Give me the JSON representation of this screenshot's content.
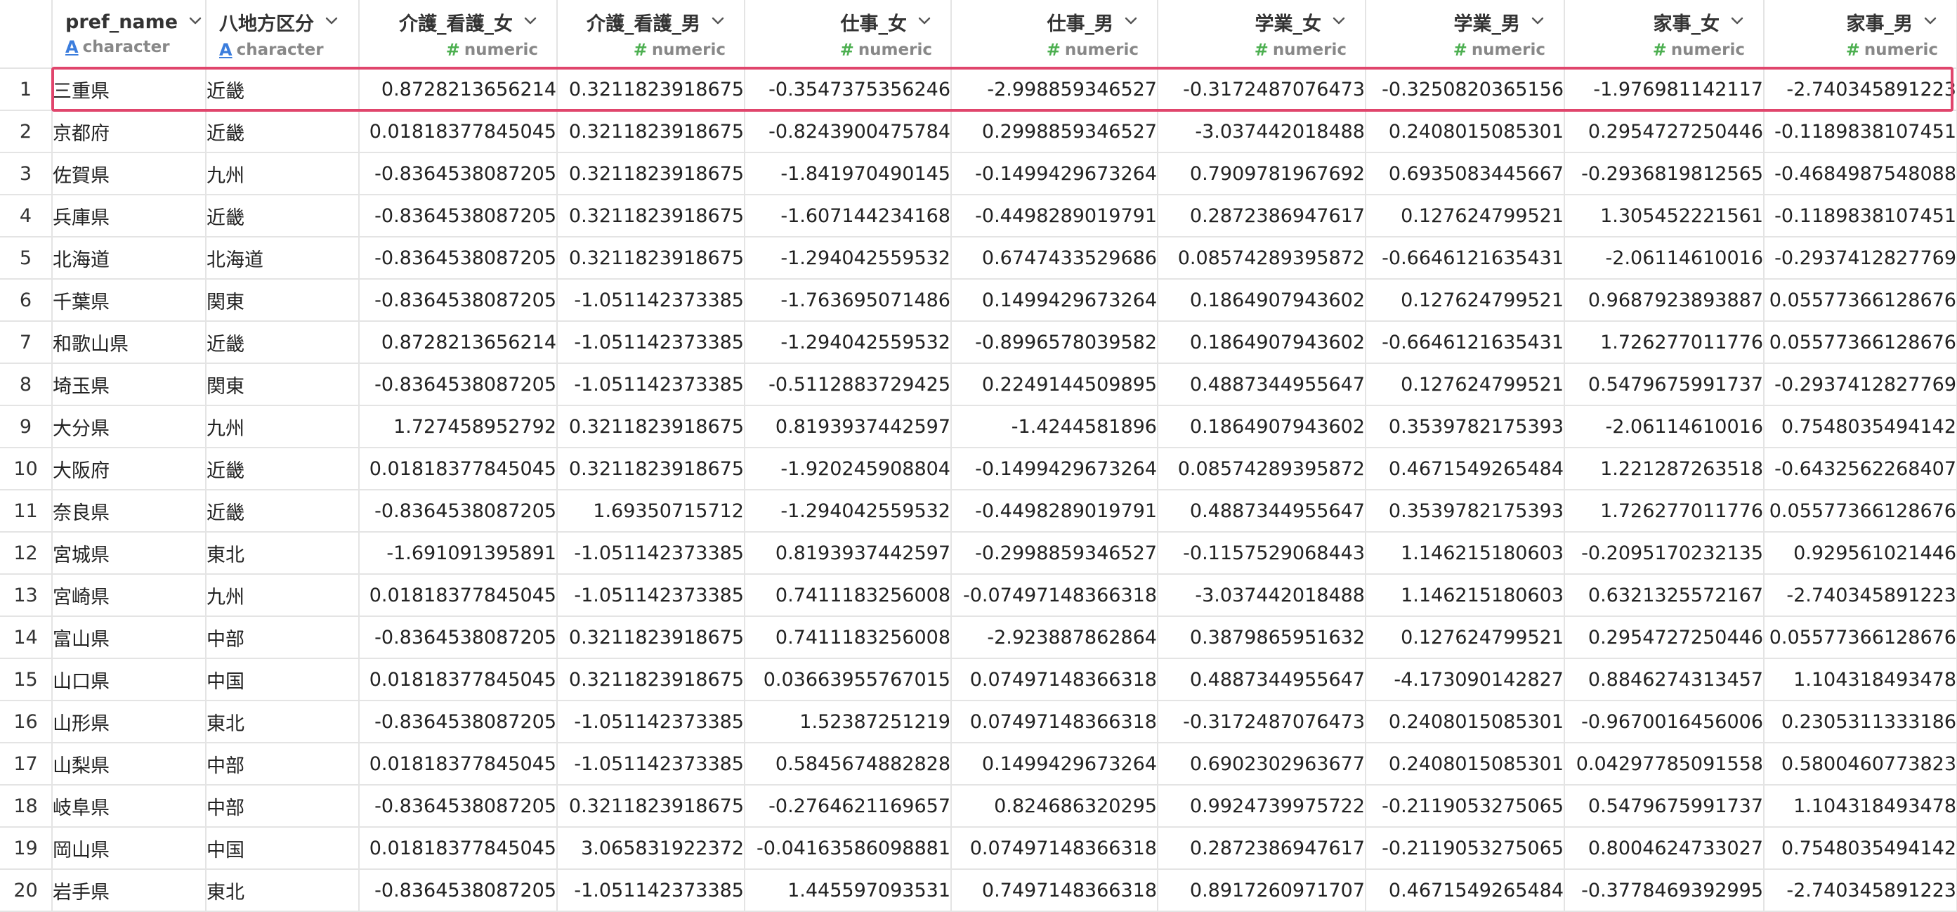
{
  "columns": [
    {
      "name": "pref_name",
      "type": "character"
    },
    {
      "name": "八地方区分",
      "type": "character"
    },
    {
      "name": "介護_看護_女",
      "type": "numeric"
    },
    {
      "name": "介護_看護_男",
      "type": "numeric"
    },
    {
      "name": "仕事_女",
      "type": "numeric"
    },
    {
      "name": "仕事_男",
      "type": "numeric"
    },
    {
      "name": "学業_女",
      "type": "numeric"
    },
    {
      "name": "学業_男",
      "type": "numeric"
    },
    {
      "name": "家事_女",
      "type": "numeric"
    },
    {
      "name": "家事_男",
      "type": "numeric"
    }
  ],
  "rows": [
    {
      "n": "1",
      "cells": [
        "三重県",
        "近畿",
        "0.8728213656214",
        "0.3211823918675",
        "-0.3547375356246",
        "-2.998859346527",
        "-0.3172487076473",
        "-0.3250820365156",
        "-1.976981142117",
        "-2.740345891223"
      ]
    },
    {
      "n": "2",
      "cells": [
        "京都府",
        "近畿",
        "0.01818377845045",
        "0.3211823918675",
        "-0.8243900475784",
        "0.2998859346527",
        "-3.037442018488",
        "0.2408015085301",
        "0.2954727250446",
        "-0.1189838107451"
      ]
    },
    {
      "n": "3",
      "cells": [
        "佐賀県",
        "九州",
        "-0.8364538087205",
        "0.3211823918675",
        "-1.841970490145",
        "-0.1499429673264",
        "0.7909781967692",
        "0.6935083445667",
        "-0.2936819812565",
        "-0.4684987548088"
      ]
    },
    {
      "n": "4",
      "cells": [
        "兵庫県",
        "近畿",
        "-0.8364538087205",
        "0.3211823918675",
        "-1.607144234168",
        "-0.4498289019791",
        "0.2872386947617",
        "0.127624799521",
        "1.305452221561",
        "-0.1189838107451"
      ]
    },
    {
      "n": "5",
      "cells": [
        "北海道",
        "北海道",
        "-0.8364538087205",
        "0.3211823918675",
        "-1.294042559532",
        "0.6747433529686",
        "0.08574289395872",
        "-0.6646121635431",
        "-2.06114610016",
        "-0.2937412827769"
      ]
    },
    {
      "n": "6",
      "cells": [
        "千葉県",
        "関東",
        "-0.8364538087205",
        "-1.051142373385",
        "-1.763695071486",
        "0.1499429673264",
        "0.1864907943602",
        "0.127624799521",
        "0.9687923893887",
        "0.05577366128676"
      ]
    },
    {
      "n": "7",
      "cells": [
        "和歌山県",
        "近畿",
        "0.8728213656214",
        "-1.051142373385",
        "-1.294042559532",
        "-0.8996578039582",
        "0.1864907943602",
        "-0.6646121635431",
        "1.726277011776",
        "0.05577366128676"
      ]
    },
    {
      "n": "8",
      "cells": [
        "埼玉県",
        "関東",
        "-0.8364538087205",
        "-1.051142373385",
        "-0.5112883729425",
        "0.2249144509895",
        "0.4887344955647",
        "0.127624799521",
        "0.5479675991737",
        "-0.2937412827769"
      ]
    },
    {
      "n": "9",
      "cells": [
        "大分県",
        "九州",
        "1.727458952792",
        "0.3211823918675",
        "0.8193937442597",
        "-1.4244581896",
        "0.1864907943602",
        "0.3539782175393",
        "-2.06114610016",
        "0.7548035494142"
      ]
    },
    {
      "n": "10",
      "cells": [
        "大阪府",
        "近畿",
        "0.01818377845045",
        "0.3211823918675",
        "-1.920245908804",
        "-0.1499429673264",
        "0.08574289395872",
        "0.4671549265484",
        "1.221287263518",
        "-0.6432562268407"
      ]
    },
    {
      "n": "11",
      "cells": [
        "奈良県",
        "近畿",
        "-0.8364538087205",
        "1.69350715712",
        "-1.294042559532",
        "-0.4498289019791",
        "0.4887344955647",
        "0.3539782175393",
        "1.726277011776",
        "0.05577366128676"
      ]
    },
    {
      "n": "12",
      "cells": [
        "宮城県",
        "東北",
        "-1.691091395891",
        "-1.051142373385",
        "0.8193937442597",
        "-0.2998859346527",
        "-0.1157529068443",
        "1.146215180603",
        "-0.2095170232135",
        "0.929561021446"
      ]
    },
    {
      "n": "13",
      "cells": [
        "宮崎県",
        "九州",
        "0.01818377845045",
        "-1.051142373385",
        "0.7411183256008",
        "-0.07497148366318",
        "-3.037442018488",
        "1.146215180603",
        "0.6321325572167",
        "-2.740345891223"
      ]
    },
    {
      "n": "14",
      "cells": [
        "富山県",
        "中部",
        "-0.8364538087205",
        "0.3211823918675",
        "0.7411183256008",
        "-2.923887862864",
        "0.3879865951632",
        "0.127624799521",
        "0.2954727250446",
        "0.05577366128676"
      ]
    },
    {
      "n": "15",
      "cells": [
        "山口県",
        "中国",
        "0.01818377845045",
        "0.3211823918675",
        "0.03663955767015",
        "0.07497148366318",
        "0.4887344955647",
        "-4.173090142827",
        "0.8846274313457",
        "1.104318493478"
      ]
    },
    {
      "n": "16",
      "cells": [
        "山形県",
        "東北",
        "-0.8364538087205",
        "-1.051142373385",
        "1.52387251219",
        "0.07497148366318",
        "-0.3172487076473",
        "0.2408015085301",
        "-0.9670016456006",
        "0.2305311333186"
      ]
    },
    {
      "n": "17",
      "cells": [
        "山梨県",
        "中部",
        "0.01818377845045",
        "-1.051142373385",
        "0.5845674882828",
        "0.1499429673264",
        "0.6902302963677",
        "0.2408015085301",
        "0.04297785091558",
        "0.5800460773823"
      ]
    },
    {
      "n": "18",
      "cells": [
        "岐阜県",
        "中部",
        "-0.8364538087205",
        "0.3211823918675",
        "-0.2764621169657",
        "0.824686320295",
        "0.9924739975722",
        "-0.2119053275065",
        "0.5479675991737",
        "1.104318493478"
      ]
    },
    {
      "n": "19",
      "cells": [
        "岡山県",
        "中国",
        "0.01818377845045",
        "3.065831922372",
        "-0.04163586098881",
        "0.07497148366318",
        "0.2872386947617",
        "-0.2119053275065",
        "0.8004624733027",
        "0.7548035494142"
      ]
    },
    {
      "n": "20",
      "cells": [
        "岩手県",
        "東北",
        "-0.8364538087205",
        "-1.051142373385",
        "1.445597093531",
        "0.7497148366318",
        "0.8917260971707",
        "0.4671549265484",
        "-0.3778469392995",
        "-2.740345891223"
      ]
    }
  ],
  "highlighted_row": "1",
  "colors": {
    "highlight": "#e0456c",
    "character_icon": "#3b7ddd",
    "numeric_icon": "#4caf50"
  }
}
